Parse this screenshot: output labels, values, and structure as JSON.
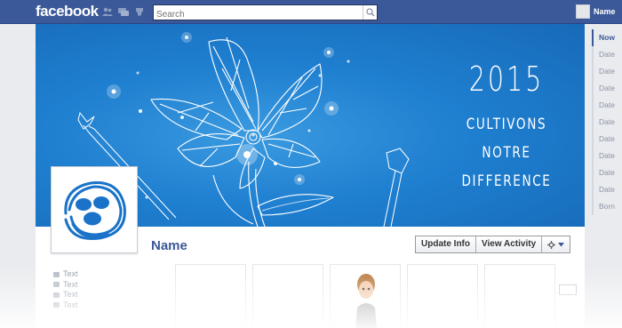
{
  "topbar": {
    "logo": "facebook",
    "search_placeholder": "Search",
    "user_name": "Name",
    "jewels": [
      "friend-requests-icon",
      "messages-icon",
      "notifications-icon"
    ]
  },
  "cover": {
    "year": "2015",
    "lines": [
      "CULTIVONS",
      "NOTRE",
      "DIFFERENCE"
    ]
  },
  "profile": {
    "name": "Name",
    "actions": {
      "update_info": "Update Info",
      "view_activity": "View Activity",
      "settings_icon": "gear-icon"
    }
  },
  "info_rows": [
    "Text",
    "Text",
    "Text",
    "Text"
  ],
  "timeline": {
    "items": [
      "Now",
      "Date",
      "Date",
      "Date",
      "Date",
      "Date",
      "Date",
      "Date",
      "Date",
      "Date",
      "Born"
    ],
    "active_index": 0
  },
  "colors": {
    "brand": "#3b5998",
    "cover": "#1f7fd0"
  }
}
